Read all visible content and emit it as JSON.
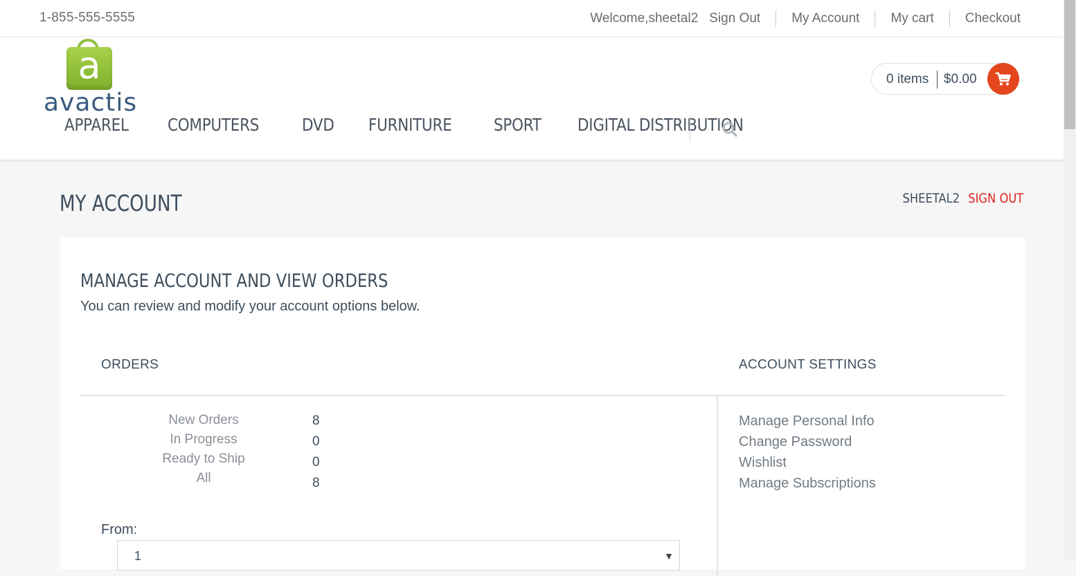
{
  "topbar": {
    "phone": "1-855-555-5555",
    "welcome": "Welcome,sheetal2",
    "sign_out": "Sign Out",
    "my_account": "My Account",
    "my_cart": "My cart",
    "checkout": "Checkout"
  },
  "header": {
    "logo_text": "avactis",
    "logo_letter": "a",
    "cart": {
      "items": "0 items",
      "total": "$0.00"
    },
    "nav": [
      "APPAREL",
      "COMPUTERS",
      "DVD",
      "FURNITURE",
      "SPORT",
      "DIGITAL DISTRIBUTION"
    ]
  },
  "page": {
    "title": "MY ACCOUNT",
    "username": "SHEETAL2",
    "sign_out": "SIGN OUT"
  },
  "panel": {
    "title": "MANAGE ACCOUNT AND VIEW ORDERS",
    "subtitle": "You can review and modify your account options below.",
    "orders_header": "ORDERS",
    "settings_header": "ACCOUNT SETTINGS",
    "stats": [
      {
        "label": "New Orders",
        "value": "8"
      },
      {
        "label": "In Progress",
        "value": "0"
      },
      {
        "label": "Ready to Ship",
        "value": "0"
      },
      {
        "label": "All",
        "value": "8"
      }
    ],
    "settings": [
      "Manage Personal Info",
      "Change Password",
      "Wishlist",
      "Manage Subscriptions"
    ],
    "from_label": "From:",
    "from_value": "1"
  },
  "colors": {
    "accent": "#e4471d",
    "signout_red": "#e02222",
    "text": "#3e4d5c",
    "logo_green": "#8cbf3c",
    "logo_blue": "#3a5a7d"
  },
  "icons": {
    "cart": "shopping-cart-icon",
    "search": "search-icon",
    "dropdown": "chevron-down-icon"
  }
}
